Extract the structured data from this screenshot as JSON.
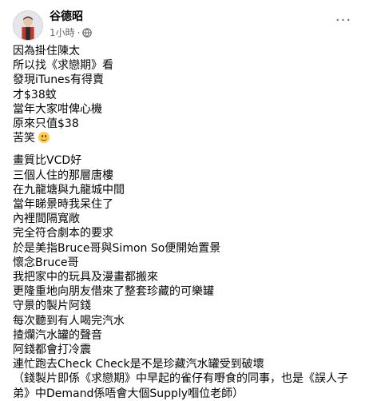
{
  "post": {
    "author": "谷德昭",
    "time": "1小時",
    "separator": "·",
    "privacy_icon": "globe-icon",
    "more_icon": "more-options-icon",
    "more_glyph": "···"
  },
  "paragraph_1": [
    "因為掛住陳太",
    "所以找《求戀期》看",
    "發現iTunes有得賣",
    "才$38蚊",
    "當年大家咁俾心機",
    "原來只值$38",
    "苦笑"
  ],
  "paragraph_2": [
    "畫質比VCD好",
    "三個人住的那層唐樓",
    "在九龍塘與九龍城中間",
    "當年睇景時我呆住了",
    "內裡間隔寬敞",
    "完全符合劇本的要求",
    "於是美指Bruce哥與Simon So便開始置景",
    "懷念Bruce哥",
    "我把家中的玩具及漫畫都搬來",
    "更隆重地向朋友借來了整套珍藏的可樂罐",
    "守景的製片阿錢",
    "每次聽到有人喝完汽水",
    "揸爛汽水罐的聲音",
    "阿錢都會打冷震",
    "連忙跑去Check Check是不是珍藏汽水罐受到破壞",
    "（錢製片即係《求戀期》中早起的雀仔有嘢食的同事，也是《誤人子",
    "弟》中Demand係唔會大個Supply嗰位老師）"
  ],
  "emoji_icon": "smiling-face-icon"
}
